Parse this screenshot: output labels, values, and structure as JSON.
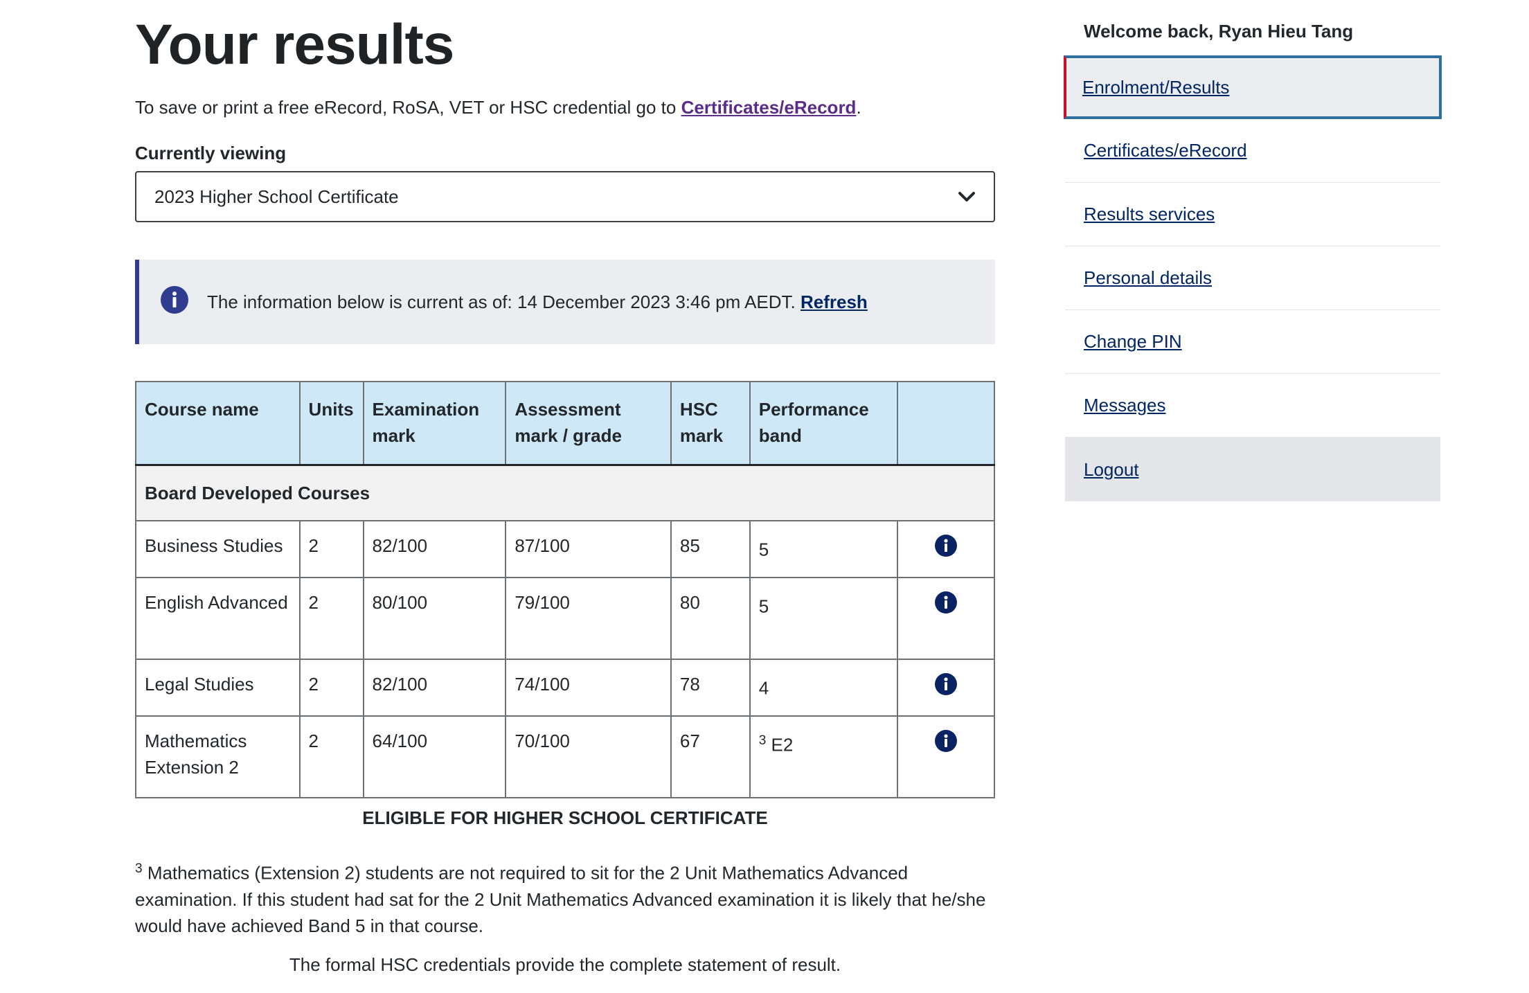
{
  "page": {
    "title": "Your results",
    "intro_text": "To save or print a free eRecord, RoSA, VET or HSC credential go to ",
    "intro_link": "Certificates/eRecord",
    "intro_end": ".",
    "currently_viewing_label": "Currently viewing",
    "select_value": "2023 Higher School Certificate",
    "info_text": "The information below is current as of: 14 December 2023 3:46 pm AEDT.",
    "refresh_link": "Refresh"
  },
  "table": {
    "headers": [
      "Course name",
      "Units",
      "Examination mark",
      "Assessment mark / grade",
      "HSC mark",
      "Performance band",
      ""
    ],
    "group_label": "Board Developed Courses",
    "rows": [
      {
        "course": "Business Studies",
        "units": "2",
        "exam": "82/100",
        "assessment": "87/100",
        "hsc": "85",
        "band_sup": "",
        "band": "5"
      },
      {
        "course": "English Advanced",
        "units": "2",
        "exam": "80/100",
        "assessment": "79/100",
        "hsc": "80",
        "band_sup": "",
        "band": "5"
      },
      {
        "course": "Legal Studies",
        "units": "2",
        "exam": "82/100",
        "assessment": "74/100",
        "hsc": "78",
        "band_sup": "",
        "band": "4"
      },
      {
        "course": "Mathematics Extension 2",
        "units": "2",
        "exam": "64/100",
        "assessment": "70/100",
        "hsc": "67",
        "band_sup": "3",
        "band": "E2"
      }
    ]
  },
  "eligible_text": "ELIGIBLE FOR HIGHER SCHOOL CERTIFICATE",
  "footnote": {
    "marker": "3",
    "text": "Mathematics (Extension 2) students are not required to sit for the 2 Unit Mathematics Advanced examination. If this student had sat for the 2 Unit Mathematics Advanced examination it is likely that he/she would have achieved Band 5 in that course."
  },
  "formal_text": "The formal HSC credentials provide the complete statement of result.",
  "sidebar": {
    "welcome": "Welcome back, Ryan Hieu Tang",
    "items": [
      {
        "label": "Enrolment/Results"
      },
      {
        "label": "Certificates/eRecord"
      },
      {
        "label": "Results services"
      },
      {
        "label": "Personal details"
      },
      {
        "label": "Change PIN"
      },
      {
        "label": "Messages"
      },
      {
        "label": "Logout"
      }
    ]
  },
  "colors": {
    "header_bg": "#cfe8f8",
    "info_bg": "#ebedf1",
    "info_accent": "#2f3c8f",
    "icon_navy": "#0a2463",
    "link_navy": "#002664",
    "visited_purple": "#5b2b8a",
    "active_focus": "#2e6f9e",
    "active_marker": "#c8102e"
  },
  "icons": {
    "info": "info-circle-icon",
    "chevron": "chevron-down-icon"
  }
}
